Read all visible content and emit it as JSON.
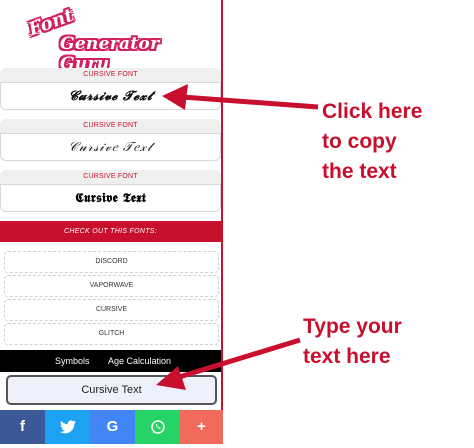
{
  "logo": {
    "line1": "Font",
    "line2": "Generator Guru"
  },
  "cards": [
    {
      "label": "CURSIVE FONT",
      "sample": "𝓒𝓾𝓻𝓼𝓲𝓿𝓮 𝓣𝓮𝔁𝓽"
    },
    {
      "label": "CURSIVE FONT",
      "sample": "𝒞𝓊𝓇𝓈𝒾𝓋𝑒 𝒯𝑒𝓍𝓉"
    },
    {
      "label": "CURSIVE FONT",
      "sample": "𝕮𝖚𝖗𝖘𝖎𝖛𝖊 𝕿𝖊𝖝𝖙"
    }
  ],
  "banner": "CHECK OUT THIS FONTS:",
  "font_links": [
    "DISCORD",
    "VAPORWAVE",
    "CURSIVE",
    "GLITCH"
  ],
  "nav": {
    "symbols": "Symbols",
    "age": "Age Calculation"
  },
  "input": {
    "value": "Cursive Text"
  },
  "share": {
    "facebook": "f",
    "twitter": "🐦",
    "google": "G",
    "whatsapp": "✆",
    "more": "+"
  },
  "annotations": {
    "copy": [
      "Click here",
      "to copy",
      "the text"
    ],
    "type": [
      "Type your",
      "text here"
    ]
  },
  "colors": {
    "accent": "#c8102e",
    "facebook": "#3b5998",
    "twitter": "#1da1f2",
    "google": "#4285f4",
    "whatsapp": "#25d366",
    "more": "#f26a5b"
  }
}
